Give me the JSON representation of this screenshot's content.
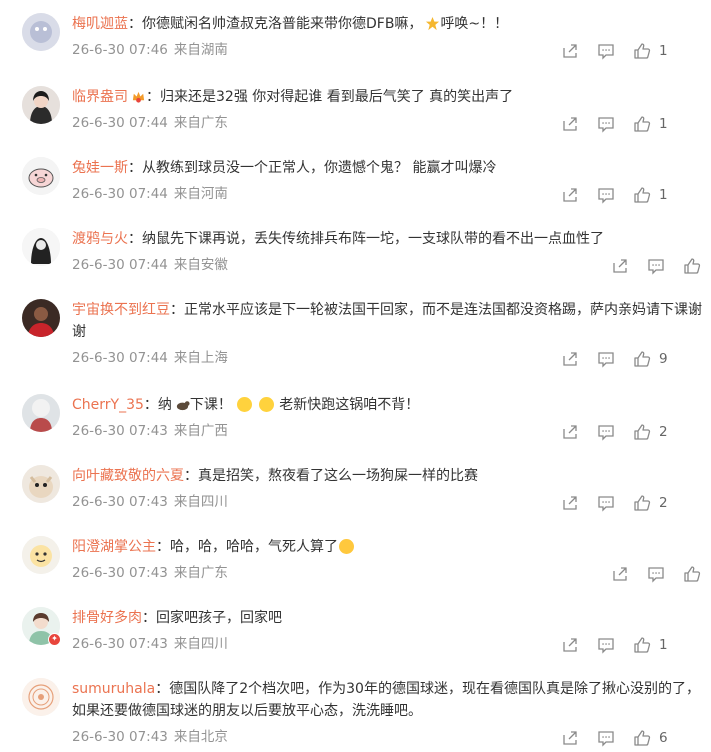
{
  "colors": {
    "username": "#eb7350",
    "meta": "#939393",
    "icon": "#8a8a8a",
    "body": "#333333"
  },
  "comments": [
    {
      "username": "梅叽迦蓝",
      "text": "：你德赋闲名帅渣叔克洛普能来带你德DFB嘛，",
      "text_tail": "呼唤~！！",
      "time": "26-6-30 07:46",
      "location": "来自湖南",
      "likes": "1"
    },
    {
      "username": "临界盎司",
      "text": "：归来还是32强 你对得起谁 看到最后气笑了 真的笑出声了",
      "time": "26-6-30 07:44",
      "location": "来自广东",
      "likes": "1"
    },
    {
      "username": "兔娃一斯",
      "text": "：从教练到球员没一个正常人，你遗憾个鬼？ 能赢才叫爆冷",
      "time": "26-6-30 07:44",
      "location": "来自河南",
      "likes": "1"
    },
    {
      "username": "渡鸦与火",
      "text": "：纳鼠先下课再说，丢失传统排兵布阵一坨，一支球队带的看不出一点血性了",
      "time": "26-6-30 07:44",
      "location": "来自安徽",
      "likes": ""
    },
    {
      "username": "宇宙换不到红豆",
      "text": "：正常水平应该是下一轮被法国干回家，而不是连法国都没资格踢，萨内亲妈请下课谢谢",
      "time": "26-6-30 07:44",
      "location": "来自上海",
      "likes": "9"
    },
    {
      "username": "CherrY_35",
      "text": "：纳",
      "text_mid": "下课！",
      "text_tail": "老新快跑这锅咱不背！",
      "time": "26-6-30 07:43",
      "location": "来自广西",
      "likes": "2"
    },
    {
      "username": "向叶藏致敬的六夏",
      "text": "：真是招笑，熬夜看了这么一场狗屎一样的比赛",
      "time": "26-6-30 07:43",
      "location": "来自四川",
      "likes": "2"
    },
    {
      "username": "阳澄湖掌公主",
      "text": "：哈，哈，哈哈，气死人算了",
      "time": "26-6-30 07:43",
      "location": "来自广东",
      "likes": ""
    },
    {
      "username": "排骨好多肉",
      "text": "：回家吧孩子，回家吧",
      "time": "26-6-30 07:43",
      "location": "来自四川",
      "likes": "1"
    },
    {
      "username": "sumuruhala",
      "text": "：德国队降了2个档次吧，作为30年的德国球迷，现在看德国队真是除了揪心没别的了，如果还要做德国球迷的朋友以后要放平心态，洗洗睡吧。",
      "time": "26-6-30 07:43",
      "location": "来自北京",
      "likes": "6"
    }
  ]
}
